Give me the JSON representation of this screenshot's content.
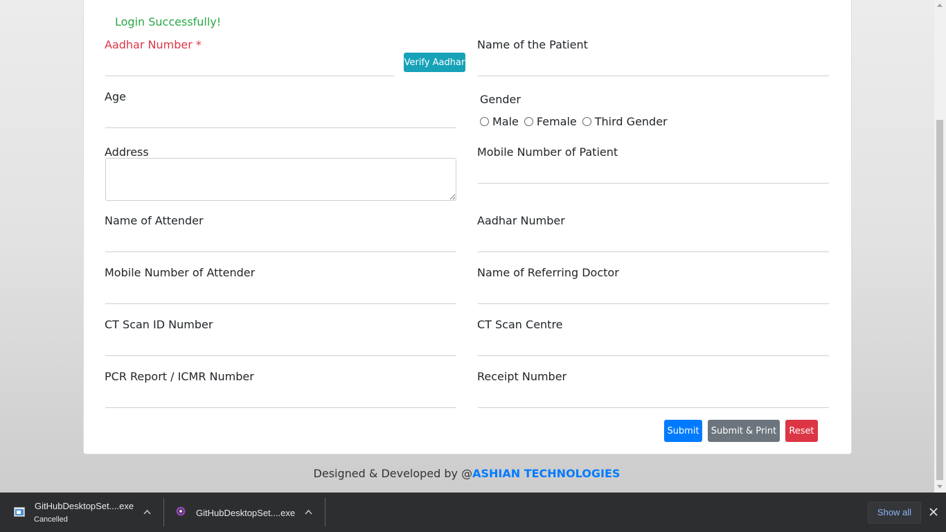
{
  "form": {
    "success_message": "Login Successfully!",
    "aadhar_label": "Aadhar Number *",
    "verify_button": "Verify Aadhar",
    "patient_name_label": "Name of the Patient",
    "age_label": "Age",
    "gender_label": "Gender",
    "gender_options": [
      "Male",
      "Female",
      "Third Gender"
    ],
    "address_label": "Address",
    "patient_mobile_label": "Mobile Number of Patient",
    "attender_name_label": "Name of Attender",
    "attender_aadhar_label": "Aadhar Number",
    "attender_mobile_label": "Mobile Number of Attender",
    "referring_doctor_label": "Name of Referring Doctor",
    "ct_scan_id_label": "CT Scan ID Number",
    "ct_scan_centre_label": "CT Scan Centre",
    "pcr_label": "PCR Report / ICMR Number",
    "receipt_label": "Receipt Number",
    "submit_button": "Submit",
    "submit_print_button": "Submit & Print",
    "reset_button": "Reset"
  },
  "footer": {
    "prefix": "Designed & Developed by @",
    "brand": "ASHIAN TECHNOLOGIES"
  },
  "downloads": {
    "items": [
      {
        "name": "GitHubDesktopSet....exe",
        "status": "Cancelled"
      },
      {
        "name": "GitHubDesktopSet....exe",
        "status": ""
      }
    ],
    "show_all": "Show all"
  },
  "colors": {
    "success": "#28a745",
    "required": "#dc3545",
    "verify": "#17a2b8",
    "submit": "#007bff",
    "submit_print": "#6c757d",
    "reset": "#dc3545",
    "brand": "#007bff"
  }
}
